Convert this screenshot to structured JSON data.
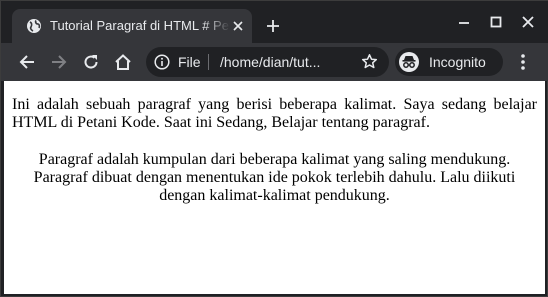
{
  "tab": {
    "title": "Tutorial Paragraf di HTML # Petani Kode"
  },
  "omnibox": {
    "scheme_label": "File",
    "url": "/home/dian/tut..."
  },
  "profile": {
    "label": "Incognito"
  },
  "page": {
    "paragraph_1": "Ini adalah sebuah paragraf yang berisi beberapa kalimat. Saya sedang belajar HTML di Petani Kode. Saat ini Sedang, Belajar tentang paragraf.",
    "paragraph_2_line_1": "Paragraf adalah kumpulan dari beberapa kalimat yang saling mendukung.",
    "paragraph_2_line_2": "Paragraf dibuat dengan menentukan ide pokok terlebih dahulu. Lalu diikuti",
    "paragraph_2_line_3": "dengan kalimat-kalimat pendukung."
  },
  "colors": {
    "titlebar": "#202124",
    "toolbar": "#35363a",
    "text": "#e8eaed",
    "page_background": "#ffffff"
  },
  "icons": [
    "globe-icon",
    "close-icon",
    "plus-icon",
    "minimize-icon",
    "maximize-icon",
    "back-icon",
    "forward-icon",
    "reload-icon",
    "home-icon",
    "info-icon",
    "star-icon",
    "incognito-icon",
    "menu-icon"
  ]
}
